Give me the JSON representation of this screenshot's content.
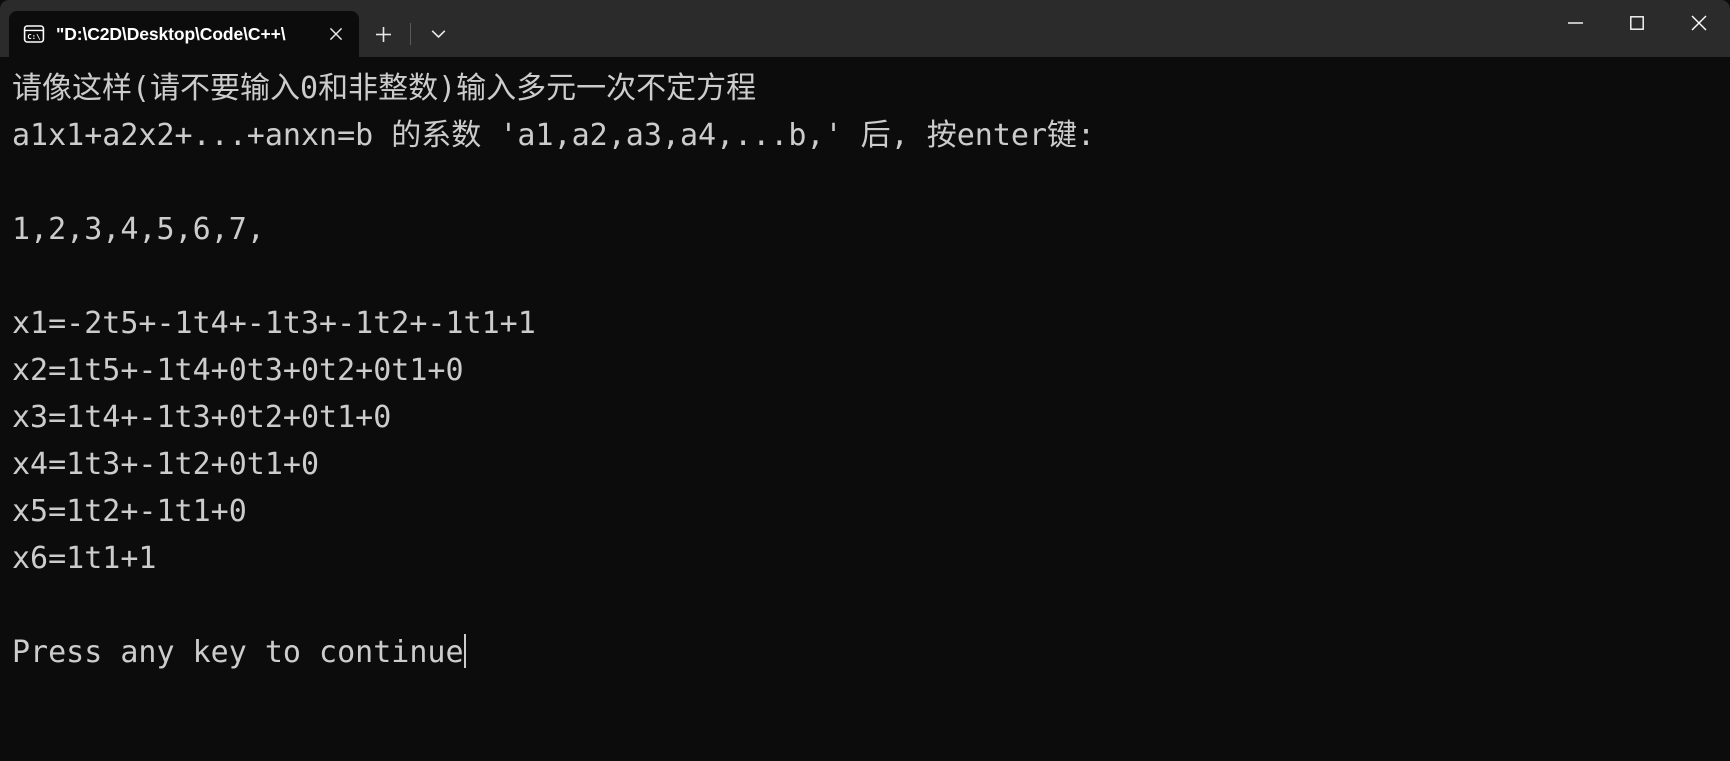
{
  "window": {
    "tab": {
      "icon": "command-prompt-icon",
      "title": "\"D:\\C2D\\Desktop\\Code\\C++\\",
      "close_label": "✕"
    },
    "new_tab_label": "+",
    "dropdown_label": "⌄",
    "controls": {
      "minimize_label": "─",
      "maximize_label": "□",
      "close_label": "✕"
    },
    "colors": {
      "titlebar_bg": "#2b2b2b",
      "terminal_bg": "#0c0c0c",
      "terminal_fg": "#cccccc",
      "close_hover": "#c42b1c"
    }
  },
  "terminal": {
    "lines": [
      "请像这样(请不要输入0和非整数)输入多元一次不定方程",
      "a1x1+a2x2+...+anxn=b 的系数 'a1,a2,a3,a4,...b,' 后, 按enter键:",
      "",
      "1,2,3,4,5,6,7,",
      "",
      "x1=-2t5+-1t4+-1t3+-1t2+-1t1+1",
      "x2=1t5+-1t4+0t3+0t2+0t1+0",
      "x3=1t4+-1t3+0t2+0t1+0",
      "x4=1t3+-1t2+0t1+0",
      "x5=1t2+-1t1+0",
      "x6=1t1+1",
      "",
      "Press any key to continue"
    ],
    "prompt_line": "请像这样(请不要输入0和非整数)输入多元一次不定方程",
    "prompt_line2": "a1x1+a2x2+...+anxn=b 的系数 'a1,a2,a3,a4,...b,' 后, 按enter键:",
    "user_input": "1,2,3,4,5,6,7,",
    "results": [
      "x1=-2t5+-1t4+-1t3+-1t2+-1t1+1",
      "x2=1t5+-1t4+0t3+0t2+0t1+0",
      "x3=1t4+-1t3+0t2+0t1+0",
      "x4=1t3+-1t2+0t1+0",
      "x5=1t2+-1t1+0",
      "x6=1t1+1"
    ],
    "footer": "Press any key to continue"
  }
}
